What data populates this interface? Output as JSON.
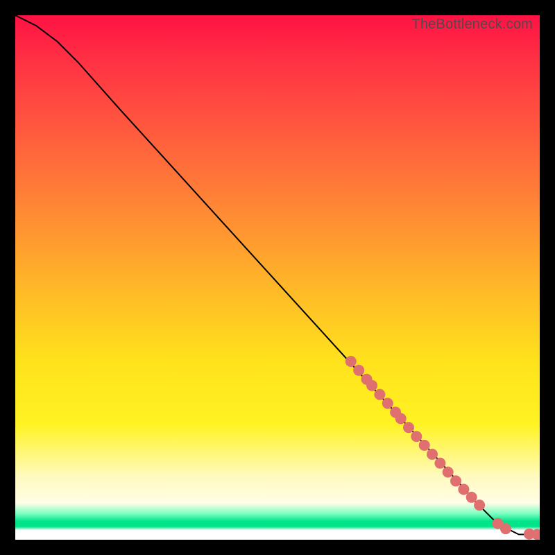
{
  "watermark": "TheBottleneck.com",
  "colors": {
    "background": "#000000",
    "curve": "#000000",
    "dot": "#e07070"
  },
  "chart_data": {
    "type": "line",
    "title": "",
    "xlabel": "",
    "ylabel": "",
    "xlim": [
      0,
      100
    ],
    "ylim": [
      0,
      100
    ],
    "series": [
      {
        "name": "curve",
        "x": [
          0,
          4,
          8,
          12,
          20,
          30,
          40,
          50,
          60,
          70,
          80,
          88,
          92,
          96,
          100
        ],
        "y": [
          100,
          98,
          95,
          91,
          82,
          71,
          60,
          49,
          38,
          27,
          16,
          7,
          3,
          1,
          1
        ]
      }
    ],
    "points": [
      {
        "x": 64,
        "y": 34
      },
      {
        "x": 65.5,
        "y": 32.3
      },
      {
        "x": 67,
        "y": 30.6
      },
      {
        "x": 68,
        "y": 29.4
      },
      {
        "x": 69.5,
        "y": 27.7
      },
      {
        "x": 71,
        "y": 26
      },
      {
        "x": 72.5,
        "y": 24.3
      },
      {
        "x": 73.5,
        "y": 23.1
      },
      {
        "x": 75,
        "y": 21.4
      },
      {
        "x": 76.5,
        "y": 19.7
      },
      {
        "x": 78,
        "y": 18
      },
      {
        "x": 79.5,
        "y": 16.3
      },
      {
        "x": 81,
        "y": 14.6
      },
      {
        "x": 82.5,
        "y": 12.9
      },
      {
        "x": 84,
        "y": 11.2
      },
      {
        "x": 85.5,
        "y": 9.6
      },
      {
        "x": 87,
        "y": 8.1
      },
      {
        "x": 88.5,
        "y": 6.6
      },
      {
        "x": 92,
        "y": 3.1
      },
      {
        "x": 93.5,
        "y": 2.1
      },
      {
        "x": 98,
        "y": 1.1
      },
      {
        "x": 99.5,
        "y": 1.0
      }
    ],
    "point_radius": 8
  }
}
